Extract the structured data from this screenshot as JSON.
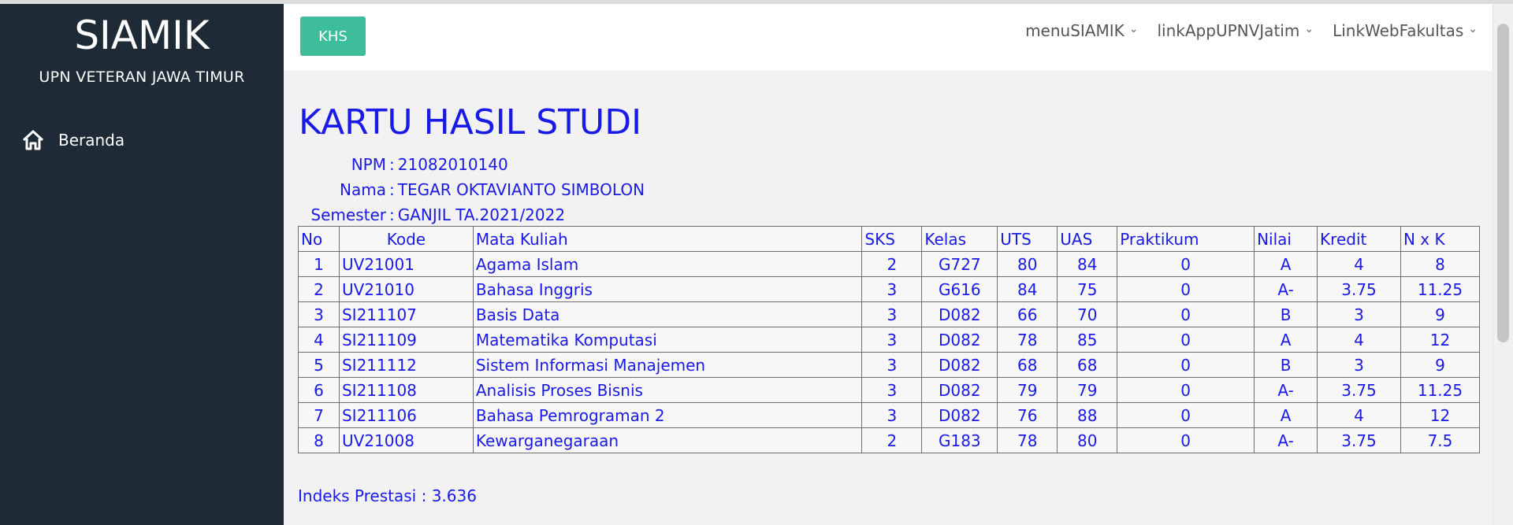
{
  "sidebar": {
    "brand_title": "SIAMIK",
    "brand_subtitle": "UPN VETERAN JAWA TIMUR",
    "nav_items": [
      {
        "label": "Beranda",
        "icon": "home-icon"
      }
    ]
  },
  "topbar": {
    "khs_button": "KHS",
    "menus": [
      "menuSIAMIK",
      "linkAppUPNVJatim",
      "LinkWebFakultas"
    ]
  },
  "page": {
    "title": "KARTU HASIL STUDI",
    "npm_label": "NPM",
    "npm_value": "21082010140",
    "nama_label": "Nama",
    "nama_value": "TEGAR OKTAVIANTO SIMBOLON",
    "semester_label": "Semester",
    "semester_value": "GANJIL TA.2021/2022"
  },
  "table": {
    "headers": [
      "No",
      "Kode",
      "Mata Kuliah",
      "SKS",
      "Kelas",
      "UTS",
      "UAS",
      "Praktikum",
      "Nilai",
      "Kredit",
      "N x K"
    ],
    "rows": [
      [
        "1",
        "UV21001",
        "Agama Islam",
        "2",
        "G727",
        "80",
        "84",
        "0",
        "A",
        "4",
        "8"
      ],
      [
        "2",
        "UV21010",
        "Bahasa Inggris",
        "3",
        "G616",
        "84",
        "75",
        "0",
        "A-",
        "3.75",
        "11.25"
      ],
      [
        "3",
        "SI211107",
        "Basis Data",
        "3",
        "D082",
        "66",
        "70",
        "0",
        "B",
        "3",
        "9"
      ],
      [
        "4",
        "SI211109",
        "Matematika Komputasi",
        "3",
        "D082",
        "78",
        "85",
        "0",
        "A",
        "4",
        "12"
      ],
      [
        "5",
        "SI211112",
        "Sistem Informasi Manajemen",
        "3",
        "D082",
        "68",
        "68",
        "0",
        "B",
        "3",
        "9"
      ],
      [
        "6",
        "SI211108",
        "Analisis Proses Bisnis",
        "3",
        "D082",
        "79",
        "79",
        "0",
        "A-",
        "3.75",
        "11.25"
      ],
      [
        "7",
        "SI211106",
        "Bahasa Pemrograman 2",
        "3",
        "D082",
        "76",
        "88",
        "0",
        "A",
        "4",
        "12"
      ],
      [
        "8",
        "UV21008",
        "Kewarganegaraan",
        "2",
        "G183",
        "78",
        "80",
        "0",
        "A-",
        "3.75",
        "7.5"
      ]
    ]
  },
  "ip": {
    "label": "Indeks Prestasi",
    "value": "3.636"
  },
  "colors": {
    "sidebar_bg": "#1e2a36",
    "accent_button": "#3ebd9b",
    "text_blue": "#1a1ae6"
  }
}
